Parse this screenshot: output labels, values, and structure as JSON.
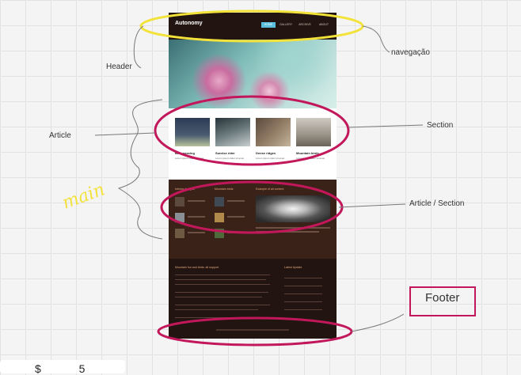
{
  "mockup": {
    "site_title": "Autonomy",
    "nav": [
      "HOME",
      "GALLERY",
      "ARCHIVE",
      "ABOUT"
    ],
    "cards": [
      {
        "title": "Blue passing",
        "text": "Lorem ipsum dolor sit amet"
      },
      {
        "title": "Sunrise rider",
        "text": "Lorem ipsum dolor sit amet"
      },
      {
        "title": "Dense ridges",
        "text": "Lorem ipsum dolor sit amet"
      },
      {
        "title": "Mountain birds",
        "text": "Lorem ipsum dolor sit amet"
      }
    ],
    "mid_headings": [
      "Interior designs",
      "Mountain birds",
      "Example of all content"
    ],
    "footer_headings": [
      "Mountain fun and birds: all support",
      "Latest Update"
    ]
  },
  "labels": {
    "header": "Header",
    "navegacao": "navegação",
    "article": "Article",
    "section": "Section",
    "main": "main",
    "article_section": "Article  / Section",
    "footer": "Footer"
  },
  "bottom_panel": {
    "glyphs": "$ 5"
  },
  "colors": {
    "yellow_ellipse": "#f2e23a",
    "magenta_ellipse": "#c2185b",
    "nav_active": "#5bc0de"
  }
}
